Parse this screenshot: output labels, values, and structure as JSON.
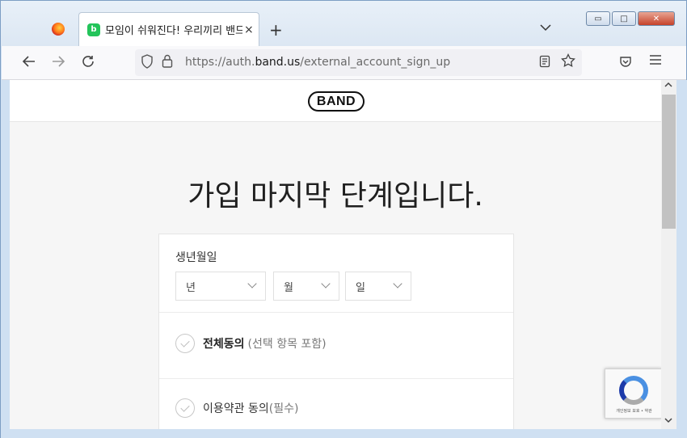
{
  "browser": {
    "tab_title": "모임이 쉬워진다! 우리끼리 밴드",
    "tab_favicon": "b",
    "tab_close": "×",
    "new_tab": "+",
    "tab_list": "⌄",
    "url_prefix": "https://auth.",
    "url_host": "band.us",
    "url_path": "/external_account_sign_up",
    "window_minimize": "▭",
    "window_maximize": "□",
    "window_close": "✕"
  },
  "page": {
    "logo": "BAND",
    "title": "가입 마지막 단계입니다.",
    "birth_label": "생년월일",
    "year_placeholder": "년",
    "month_placeholder": "월",
    "day_placeholder": "일",
    "agree_all_strong": "전체동의",
    "agree_all_sub": "(선택 항목 포함)",
    "agree_terms": "이용약관 동의",
    "agree_terms_required": "(필수)"
  },
  "recaptcha": {
    "footer": "개인정보 보호 • 약관"
  },
  "colors": {
    "brand_green": "#23c45a",
    "page_bg": "#f6f6f6"
  },
  "icons": {
    "back": "arrow-left-icon",
    "forward": "arrow-right-icon",
    "reload": "reload-icon",
    "shield": "shield-icon",
    "lock": "lock-icon",
    "reader": "reader-view-icon",
    "bookmark": "star-icon",
    "pocket": "pocket-icon",
    "menu": "hamburger-menu-icon"
  }
}
